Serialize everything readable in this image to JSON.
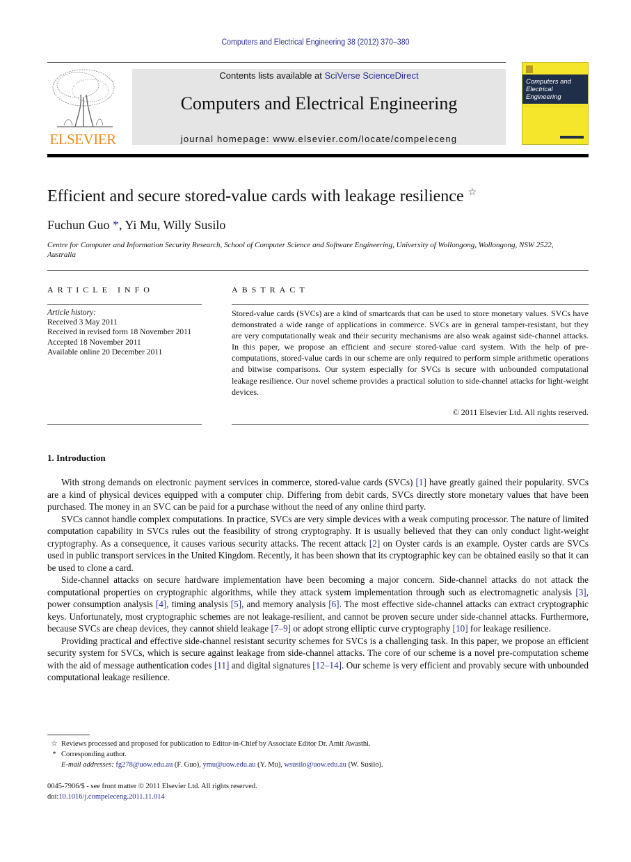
{
  "header": {
    "journal_reference": "Computers and Electrical Engineering 38 (2012) 370–380",
    "contents_prefix": "Contents lists available at ",
    "contents_link": "SciVerse ScienceDirect",
    "journal_title": "Computers and Electrical Engineering",
    "homepage_prefix": "journal homepage: ",
    "homepage_url": "www.elsevier.com/locate/compeleceng",
    "publisher_logo_text": "ELSEVIER",
    "cover": {
      "title_line1": "Computers and",
      "title_line2": "Electrical Engineering",
      "color": "#f4e62a",
      "band_color": "#1f2f4a"
    },
    "logo_color": "#f08a1a",
    "link_color": "#2a2f8f"
  },
  "article": {
    "title": "Efficient and secure stored-value cards with leakage resilience",
    "title_note_symbol": "☆",
    "authors": [
      {
        "name": "Fuchun Guo",
        "mark": "*"
      },
      {
        "name": "Yi Mu",
        "mark": ""
      },
      {
        "name": "Willy Susilo",
        "mark": ""
      }
    ],
    "affiliation": "Centre for Computer and Information Security Research, School of Computer Science and Software Engineering, University of Wollongong, Wollongong, NSW 2522, Australia"
  },
  "article_info": {
    "heading": "ARTICLE INFO",
    "history_label": "Article history:",
    "history": [
      "Received 3 May 2011",
      "Received in revised form 18 November 2011",
      "Accepted 18 November 2011",
      "Available online 20 December 2011"
    ]
  },
  "abstract": {
    "heading": "ABSTRACT",
    "text": "Stored-value cards (SVCs) are a kind of smartcards that can be used to store monetary values. SVCs have demonstrated a wide range of applications in commerce. SVCs are in general tamper-resistant, but they are very computationally weak and their security mechanisms are also weak against side-channel attacks. In this paper, we propose an efficient and secure stored-value card system. With the help of pre-computations, stored-value cards in our scheme are only required to perform simple arithmetic operations and bitwise comparisons. Our system especially for SVCs is secure with unbounded computational leakage resilience. Our novel scheme provides a practical solution to side-channel attacks for light-weight devices.",
    "copyright": "© 2011 Elsevier Ltd. All rights reserved."
  },
  "introduction": {
    "heading": "1. Introduction",
    "p1": [
      "With strong demands on electronic payment services in commerce, stored-value cards (SVCs) ",
      "[1]",
      " have greatly gained their popularity. SVCs are a kind of physical devices equipped with a computer chip. Differing from debit cards, SVCs directly store monetary values that have been purchased. The money in an SVC can be paid for a purchase without the need of any online third party."
    ],
    "p2": [
      "SVCs cannot handle complex computations. In practice, SVCs are very simple devices with a weak computing processor. The nature of limited computation capability in SVCs rules out the feasibility of strong cryptography. It is usually believed that they can only conduct light-weight cryptography. As a consequence, it causes various security attacks. The recent attack ",
      "[2]",
      " on Oyster cards is an example. Oyster cards are SVCs used in public transport services in the United Kingdom. Recently, it has been shown that its cryptographic key can be obtained easily so that it can be used to clone a card."
    ],
    "p3": [
      "Side-channel attacks on secure hardware implementation have been becoming a major concern. Side-channel attacks do not attack the computational properties on cryptographic algorithms, while they attack system implementation through such as electromagnetic analysis ",
      "[3]",
      ", power consumption analysis ",
      "[4]",
      ", timing analysis ",
      "[5]",
      ", and memory analysis ",
      "[6]",
      ". The most effective side-channel attacks can extract cryptographic keys. Unfortunately, most cryptographic schemes are not leakage-resilient, and cannot be proven secure under side-channel attacks. Furthermore, because SVCs are cheap devices, they cannot shield leakage ",
      "[7–9]",
      " or adopt strong elliptic curve cryptography ",
      "[10]",
      " for leakage resilience."
    ],
    "p4": [
      "Providing practical and effective side-channel resistant security schemes for SVCs is a challenging task. In this paper, we propose an efficient security system for SVCs, which is secure against leakage from side-channel attacks. The core of our scheme is a novel pre-computation scheme with the aid of message authentication codes ",
      "[11]",
      " and digital signatures ",
      "[12–14]",
      ". Our scheme is very efficient and provably secure with unbounded computational leakage resilience."
    ]
  },
  "footnotes": {
    "note1_symbol": "☆",
    "note1": "Reviews processed and proposed for publication to Editor-in-Chief by Associate Editor Dr. Amit Awasthi.",
    "note2_symbol": "*",
    "note2": "Corresponding author.",
    "email_label": "E-mail addresses:",
    "emails": [
      {
        "address": "fg278@uow.edu.au",
        "who": " (F. Guo), "
      },
      {
        "address": "ymu@uow.edu.au",
        "who": " (Y. Mu), "
      },
      {
        "address": "wsusilo@uow.edu.au",
        "who": " (W. Susilo)."
      }
    ]
  },
  "front_matter": {
    "issn_line": "0045-7906/$ - see front matter © 2011 Elsevier Ltd. All rights reserved.",
    "doi_prefix": "doi:",
    "doi": "10.1016/j.compeleceng.2011.11.014"
  }
}
